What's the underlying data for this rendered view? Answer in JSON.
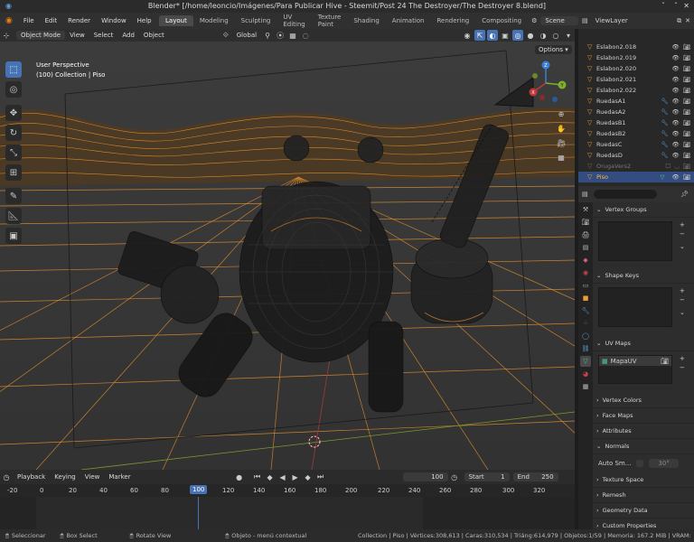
{
  "window": {
    "title": "Blender* [/home/leoncio/Imágenes/Para Publicar Hive - Steemit/Post 24 The Destroyer/The Destroyer 8.blend]"
  },
  "menubar": {
    "items": [
      "File",
      "Edit",
      "Render",
      "Window",
      "Help"
    ],
    "workspaces": [
      "Layout",
      "Modeling",
      "Sculpting",
      "UV Editing",
      "Texture Paint",
      "Shading",
      "Animation",
      "Rendering",
      "Compositing"
    ],
    "active_workspace": "Layout",
    "scene": "Scene"
  },
  "viewport_header": {
    "mode": "Object Mode",
    "menus": [
      "View",
      "Select",
      "Add",
      "Object"
    ],
    "orientation": "Global",
    "options": "Options"
  },
  "viewport": {
    "perspective": "User Perspective",
    "collection": "(100) Collection | Piso"
  },
  "outliner": {
    "view_layer": "ViewLayer",
    "rows": [
      {
        "name": "Eslabon2.018"
      },
      {
        "name": "Eslabon2.019"
      },
      {
        "name": "Eslabon2.020"
      },
      {
        "name": "Eslabon2.021"
      },
      {
        "name": "Eslabon2.022"
      },
      {
        "name": "RuedasA1"
      },
      {
        "name": "RuedasA2"
      },
      {
        "name": "RuedasB1"
      },
      {
        "name": "RuedasB2"
      },
      {
        "name": "RuedasC"
      },
      {
        "name": "RuedasD"
      },
      {
        "name": "OrugaVers2"
      },
      {
        "name": "Piso"
      }
    ],
    "selected": "Piso"
  },
  "properties": {
    "panels": {
      "vertex_groups": "Vertex Groups",
      "shape_keys": "Shape Keys",
      "uv_maps": "UV Maps",
      "uv_map_item": "MapaUV",
      "vertex_colors": "Vertex Colors",
      "face_maps": "Face Maps",
      "attributes": "Attributes",
      "normals": "Normals",
      "auto_smooth": "Auto Sm...",
      "auto_smooth_value": "30°",
      "texture_space": "Texture Space",
      "remesh": "Remesh",
      "geometry_data": "Geometry Data",
      "custom_properties": "Custom Properties"
    }
  },
  "timeline": {
    "menus": [
      "Playback",
      "Keying",
      "View",
      "Marker"
    ],
    "current_frame": "100",
    "start_label": "Start",
    "start": "1",
    "end_label": "End",
    "end": "250",
    "ticks": [
      "-20",
      "0",
      "20",
      "40",
      "60",
      "80",
      "100",
      "120",
      "140",
      "160",
      "180",
      "200",
      "220",
      "240",
      "260",
      "280",
      "300",
      "320"
    ]
  },
  "statusbar": {
    "select": "Seleccionar",
    "box_select": "Box Select",
    "rotate_view": "Rotate View",
    "context_menu": "Objeto - menú contextual",
    "stats": "Collection | Piso | Vértices:308,613 | Caras:310,534 | Triáng:614,979 | Objetos:1/59 | Memoria: 167.2 MiB | VRAM: 0.5/2"
  },
  "colors": {
    "accent": "#4772b3",
    "wire_orange": "#e8902a",
    "selected_row": "#334d80"
  }
}
